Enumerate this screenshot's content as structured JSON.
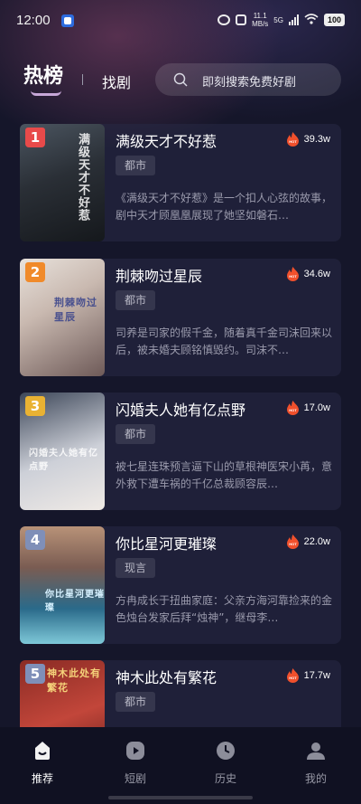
{
  "status_bar": {
    "time": "12:00",
    "net_speed_value": "11.1",
    "net_speed_unit": "MB/s",
    "signal_type": "5G",
    "battery": "100"
  },
  "header": {
    "tabs": [
      {
        "label": "热榜",
        "active": true
      },
      {
        "label": "找剧",
        "active": false
      }
    ],
    "search_placeholder": "即刻搜索免费好剧"
  },
  "list": [
    {
      "rank": "1",
      "rank_color": "#e84a4a",
      "title": "满级天才不好惹",
      "hot": "39.3w",
      "tag": "都市",
      "desc": "《满级天才不好惹》是一个扣人心弦的故事，剧中天才顾凰凰展现了她坚如磐石…",
      "poster_text": "满级天才不好惹"
    },
    {
      "rank": "2",
      "rank_color": "#f08a2a",
      "title": "荆棘吻过星辰",
      "hot": "34.6w",
      "tag": "都市",
      "desc": "司养是司家的假千金，随着真千金司沫回来以后，被未婚夫顾铭慎毁约。司沫不…",
      "poster_text": "荆棘吻过星辰"
    },
    {
      "rank": "3",
      "rank_color": "#e9b233",
      "title": "闪婚夫人她有亿点野",
      "hot": "17.0w",
      "tag": "都市",
      "desc": "被七星连珠预言逼下山的草根神医宋小苒，意外救下遭车祸的千亿总裁顾容辰…",
      "poster_text": "闪婚夫人她有亿点野"
    },
    {
      "rank": "4",
      "rank_color": "#7f8fb8",
      "title": "你比星河更璀璨",
      "hot": "22.0w",
      "tag": "现言",
      "desc": "方冉成长于扭曲家庭：父亲方海河靠捡来的金色烛台发家后拜“烛神”，继母李…",
      "poster_text": "你比星河更璀璨"
    },
    {
      "rank": "5",
      "rank_color": "#7f8fb8",
      "title": "神木此处有繁花",
      "hot": "17.7w",
      "tag": "都市",
      "desc": "",
      "poster_text": "神木此处有繁花"
    }
  ],
  "nav": [
    {
      "label": "推荐",
      "icon": "home-icon",
      "active": true
    },
    {
      "label": "短剧",
      "icon": "play-icon",
      "active": false
    },
    {
      "label": "历史",
      "icon": "clock-icon",
      "active": false
    },
    {
      "label": "我的",
      "icon": "user-icon",
      "active": false
    }
  ],
  "colors": {
    "background": "#15162a",
    "hot_icon": "#f0502c",
    "active_underline": "#c7a7d8"
  }
}
